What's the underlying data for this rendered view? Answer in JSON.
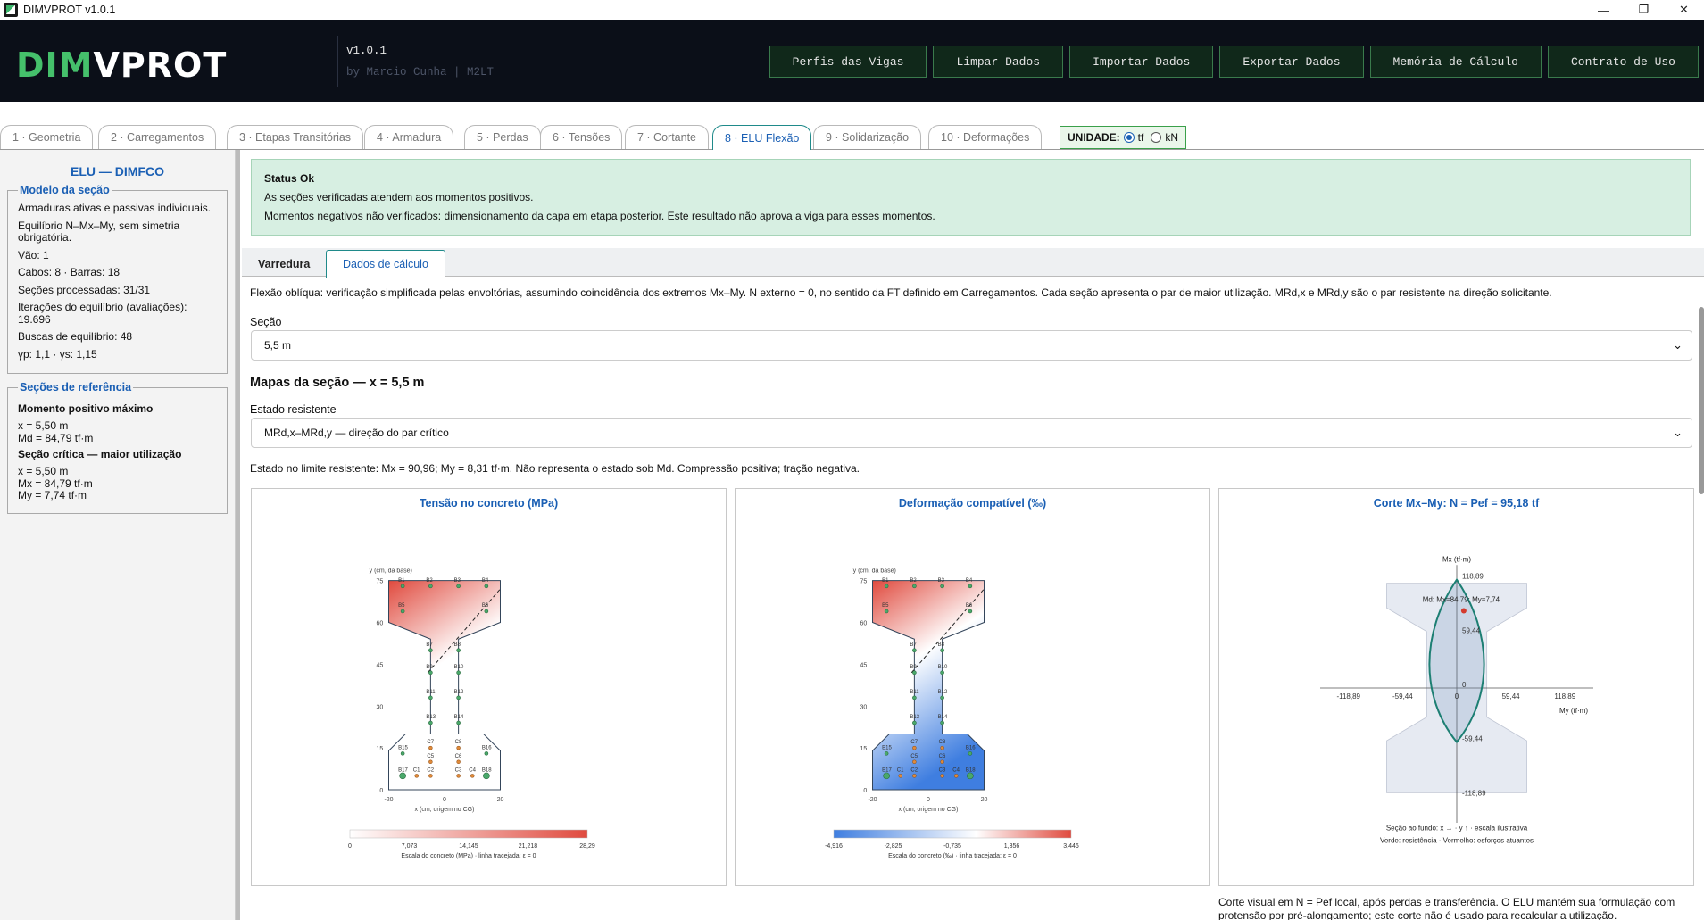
{
  "window": {
    "title": "DIMVPROT v1.0.1",
    "min": "—",
    "restore": "❐",
    "close": "✕"
  },
  "header": {
    "logo_a": "DIM",
    "logo_b": "VPROT",
    "version": "v1.0.1",
    "byline": "by Marcio Cunha  |  M2LT",
    "buttons": [
      "Perfis das Vigas",
      "Limpar Dados",
      "Importar Dados",
      "Exportar Dados",
      "Memória de Cálculo",
      "Contrato de Uso"
    ]
  },
  "tabs": [
    "1 · Geometria",
    "2 · Carregamentos",
    "3 · Etapas Transitórias",
    "4 · Armadura",
    "5 · Perdas",
    "6 · Tensões",
    "7 · Cortante",
    "8 · ELU Flexão",
    "9 · Solidarização",
    "10 · Deformações"
  ],
  "unit": {
    "label": "UNIDADE:",
    "opt1": "tf",
    "opt2": "kN"
  },
  "sidebar": {
    "title": "ELU — DIMFCO",
    "model_legend": "Modelo da seção",
    "model_lines": [
      "Armaduras ativas e passivas individuais.",
      "Equilíbrio N–Mx–My, sem simetria obrigatória.",
      "Vão: 1",
      "Cabos: 8 · Barras: 18",
      "Seções processadas: 31/31",
      "Iterações do equilíbrio (avaliações): 19.696",
      "Buscas de equilíbrio: 48",
      "γp: 1,1 · γs: 1,15"
    ],
    "ref_legend": "Seções de referência",
    "ref_h1": "Momento positivo máximo",
    "ref_l1": [
      "x = 5,50 m",
      "Md = 84,79 tf·m"
    ],
    "ref_h2": "Seção crítica — maior utilização",
    "ref_l2": [
      "x = 5,50 m",
      "Mx = 84,79 tf·m",
      "My = 7,74 tf·m"
    ]
  },
  "status": {
    "title": "Status Ok",
    "line1": "As seções verificadas atendem aos momentos positivos.",
    "line2": "Momentos negativos não verificados: dimensionamento da capa em etapa posterior. Este resultado não aprova a viga para esses momentos."
  },
  "subtabs": [
    "Varredura",
    "Dados de cálculo"
  ],
  "desc": "Flexão oblíqua: verificação simplificada pelas envoltórias, assumindo coincidência dos extremos Mx–My. N externo = 0, no sentido da FT definido em Carregamentos. Cada seção apresenta o par de maior utilização. MRd,x e MRd,y são o par resistente na direção solicitante.",
  "secao_label": "Seção",
  "secao_value": "5,5 m",
  "maps_title": "Mapas da seção — x = 5,5 m",
  "estado_label": "Estado resistente",
  "estado_value": "MRd,x–MRd,y — direção do par crítico",
  "estado_desc": "Estado no limite resistente: Mx = 90,96; My = 8,31 tf·m. Não representa o estado sob Md. Compressão positiva; tração negativa.",
  "panel1": {
    "title": "Tensão no concreto (MPa)",
    "scale": [
      "0",
      "7,073",
      "14,145",
      "21,218",
      "28,29"
    ],
    "caption": "Escala do concreto (MPa) · linha tracejada: ε = 0",
    "from": "#ffffff",
    "to": "#e04a3e"
  },
  "panel2": {
    "title": "Deformação compatível (‰)",
    "scale": [
      "-4,916",
      "-2,825",
      "-0,735",
      "1,356",
      "3,446"
    ],
    "caption": "Escala do concreto (‰) · linha tracejada: ε = 0",
    "from": "#3f7ee0",
    "to": "#e04a3e"
  },
  "section_axes": {
    "ylabel": "y (cm, da base)",
    "xlabel": "x (cm, origem no CG)",
    "yticks": [
      "0",
      "15",
      "30",
      "45",
      "60",
      "75"
    ],
    "xticks": [
      "-20",
      "0",
      "20"
    ]
  },
  "bars": [
    "B1",
    "B2",
    "B3",
    "B4",
    "B5",
    "B6",
    "B7",
    "B8",
    "B9",
    "B10",
    "B11",
    "B12",
    "B13",
    "B14",
    "B15",
    "B16",
    "B17",
    "B18"
  ],
  "cables": [
    "C1",
    "C2",
    "C3",
    "C4",
    "C5",
    "C6",
    "C7",
    "C8"
  ],
  "panel3": {
    "title": "Corte Mx–My: N = Pef = 95,18 tf",
    "yaxis": "Mx (tf·m)",
    "xaxis": "My (tf·m)",
    "yticks": [
      "118,89",
      "59,44",
      "0",
      "-59,44",
      "-118,89"
    ],
    "xticks": [
      "-118,89",
      "-59,44",
      "0",
      "59,44",
      "118,89"
    ],
    "point": "Md: Mx=84,79; My=7,74",
    "cap1": "Seção ao fundo: x → · y ↑ · escala ilustrativa",
    "cap2": "Verde: resistência · Vermelho: esforços atuantes"
  },
  "chart_data": {
    "type": "scatter",
    "title": "Corte Mx–My: N = Pef = 95,18 tf",
    "xlabel": "My (tf·m)",
    "ylabel": "Mx (tf·m)",
    "xlim": [
      -118.89,
      118.89
    ],
    "ylim": [
      -118.89,
      118.89
    ],
    "series": [
      {
        "name": "Md",
        "x": [
          7.74
        ],
        "y": [
          84.79
        ]
      }
    ]
  },
  "note": "Corte visual em N = Pef local, após perdas e transferência. O ELU mantém sua formulação com protensão por pré-alongamento; este corte não é usado para recalcular a utilização."
}
